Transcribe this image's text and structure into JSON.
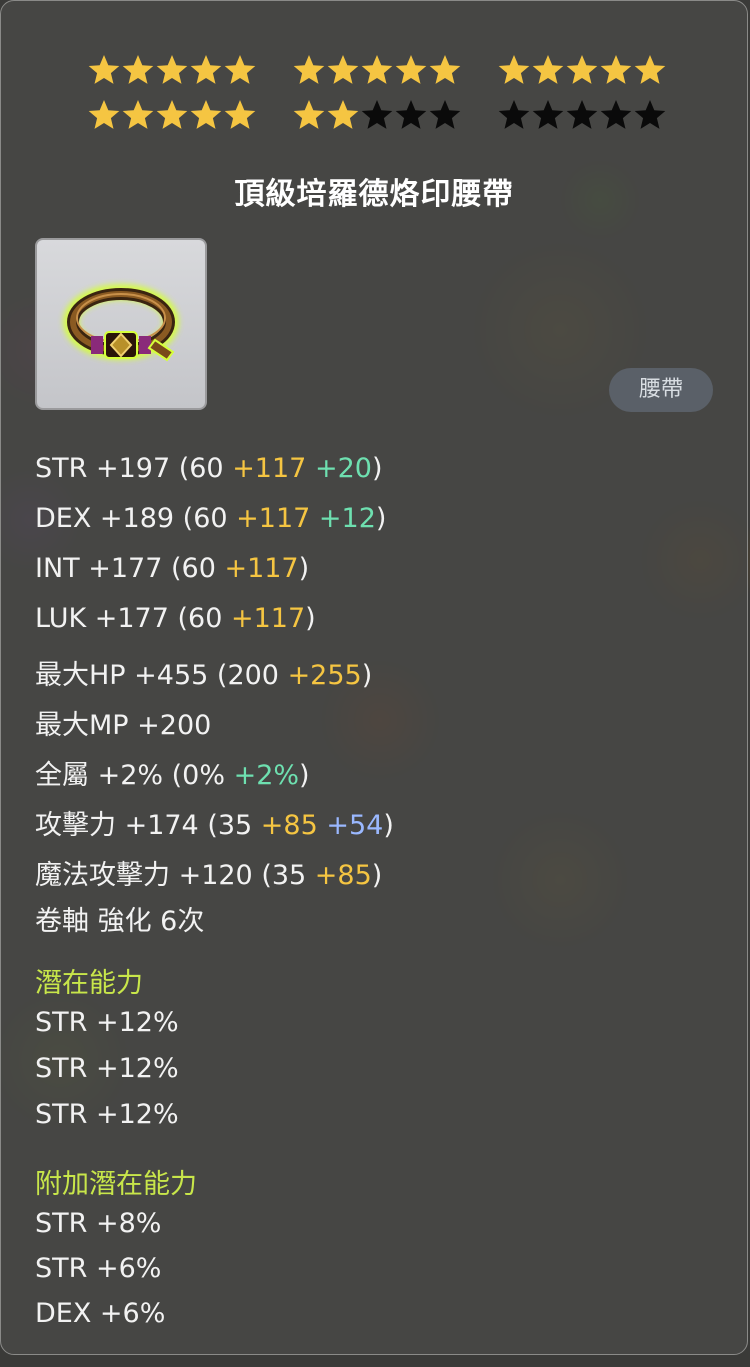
{
  "stars": {
    "rows": [
      {
        "groups": [
          [
            "on",
            "on",
            "on",
            "on",
            "on"
          ],
          [
            "on",
            "on",
            "on",
            "on",
            "on"
          ],
          [
            "on",
            "on",
            "on",
            "on",
            "on"
          ]
        ]
      },
      {
        "groups": [
          [
            "on",
            "on",
            "on",
            "on",
            "on"
          ],
          [
            "on",
            "on",
            "off",
            "off",
            "off"
          ],
          [
            "off",
            "off",
            "off",
            "off",
            "off"
          ]
        ]
      }
    ],
    "filled": 22,
    "total": 30,
    "on_color": "#f5c542",
    "off_color": "#0a0a0a"
  },
  "item": {
    "name": "頂級培羅德烙印腰帶",
    "type_label": "腰帶",
    "icon": "belt-icon"
  },
  "stats": [
    {
      "label": "STR +197 (60 ",
      "parts": [
        {
          "t": "+117",
          "c": "y"
        },
        {
          "t": " ",
          "c": ""
        },
        {
          "t": "+20",
          "c": "g"
        }
      ],
      "close": ")"
    },
    {
      "label": "DEX +189 (60 ",
      "parts": [
        {
          "t": "+117",
          "c": "y"
        },
        {
          "t": " ",
          "c": ""
        },
        {
          "t": "+12",
          "c": "g"
        }
      ],
      "close": ")"
    },
    {
      "label": "INT +177 (60 ",
      "parts": [
        {
          "t": "+117",
          "c": "y"
        }
      ],
      "close": ")"
    },
    {
      "label": "LUK +177 (60 ",
      "parts": [
        {
          "t": "+117",
          "c": "y"
        }
      ],
      "close": ")"
    },
    {
      "label": "最大HP +455 (200 ",
      "parts": [
        {
          "t": "+255",
          "c": "y"
        }
      ],
      "close": ")"
    },
    {
      "label": "最大MP +200",
      "parts": [],
      "close": ""
    },
    {
      "label": "全屬 +2% (0% ",
      "parts": [
        {
          "t": "+2%",
          "c": "g"
        }
      ],
      "close": ")"
    },
    {
      "label": "攻擊力 +174  (35 ",
      "parts": [
        {
          "t": "+85",
          "c": "y"
        },
        {
          "t": " ",
          "c": ""
        },
        {
          "t": "+54",
          "c": "b"
        }
      ],
      "close": ")"
    },
    {
      "label": "魔法攻擊力 +120  (35 ",
      "parts": [
        {
          "t": "+85",
          "c": "y"
        }
      ],
      "close": ")"
    },
    {
      "label": "卷軸 強化 6次",
      "parts": [],
      "close": ""
    }
  ],
  "potential": {
    "title": "潛在能力",
    "lines": [
      "STR +12%",
      "STR +12%",
      "STR +12%"
    ]
  },
  "additional_potential": {
    "title": "附加潛在能力",
    "lines": [
      "STR +8%",
      "STR +6%",
      "DEX +6%"
    ]
  }
}
